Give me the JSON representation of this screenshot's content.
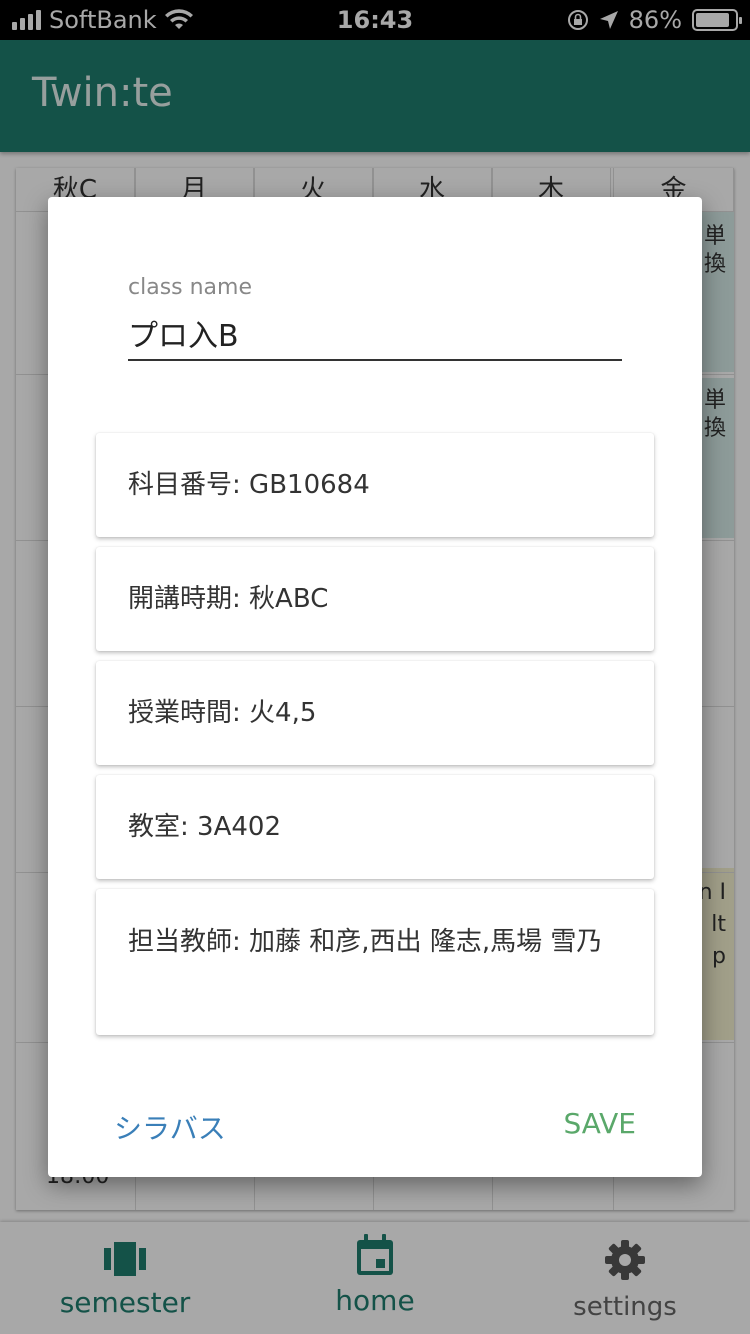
{
  "status_bar": {
    "carrier": "SoftBank",
    "time": "16:43",
    "battery_percent": "86%",
    "battery_level": 0.86
  },
  "app": {
    "title": "Twin:te"
  },
  "timetable": {
    "term": "秋C",
    "days": [
      "月",
      "火",
      "水",
      "木",
      "金"
    ],
    "time_label": "18:00",
    "peek_texts": [
      "単",
      "換",
      "単",
      "換",
      "n I",
      "lt",
      "p"
    ]
  },
  "dialog": {
    "class_name_label": "class name",
    "class_name_value": "プロ入B",
    "cards": [
      {
        "label": "科目番号",
        "value": "GB10684"
      },
      {
        "label": "開講時期",
        "value": "秋ABC"
      },
      {
        "label": "授業時間",
        "value": "火4,5"
      },
      {
        "label": "教室",
        "value": "3A402"
      },
      {
        "label": "担当教師",
        "value": "加藤 和彦,西出 隆志,馬場 雪乃"
      }
    ],
    "syllabus_label": "シラバス",
    "save_label": "SAVE",
    "colors": {
      "syllabus": "#3a7fb8",
      "save": "#5aa86a"
    }
  },
  "bottom_nav": {
    "items": [
      {
        "label": "semester",
        "icon": "semester-icon",
        "color": "#1f7d6e"
      },
      {
        "label": "home",
        "icon": "calendar-icon",
        "color": "#1f7d6e"
      },
      {
        "label": "settings",
        "icon": "gear-icon",
        "color": "#666666"
      }
    ]
  }
}
